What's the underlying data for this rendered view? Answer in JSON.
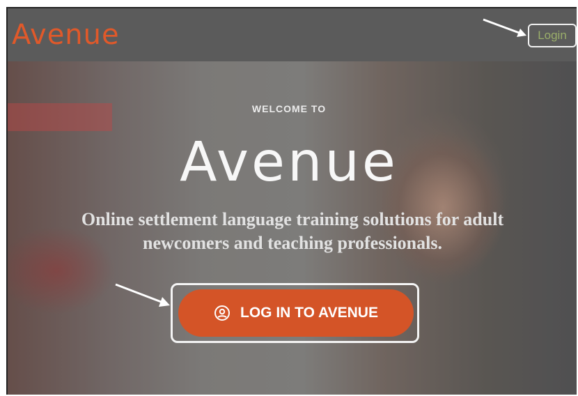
{
  "header": {
    "logo_text": "Avenue",
    "login_label": "Login"
  },
  "hero": {
    "welcome_text": "WELCOME TO",
    "title": "Avenue",
    "tagline": "Online settlement language training solutions for adult newcomers and teaching professionals.",
    "cta_label": "LOG IN TO AVENUE",
    "cta_icon": "user-circle-icon"
  },
  "colors": {
    "brand_orange": "#d45427",
    "header_bg": "#5b5b5b",
    "login_text": "#9aae6a"
  }
}
